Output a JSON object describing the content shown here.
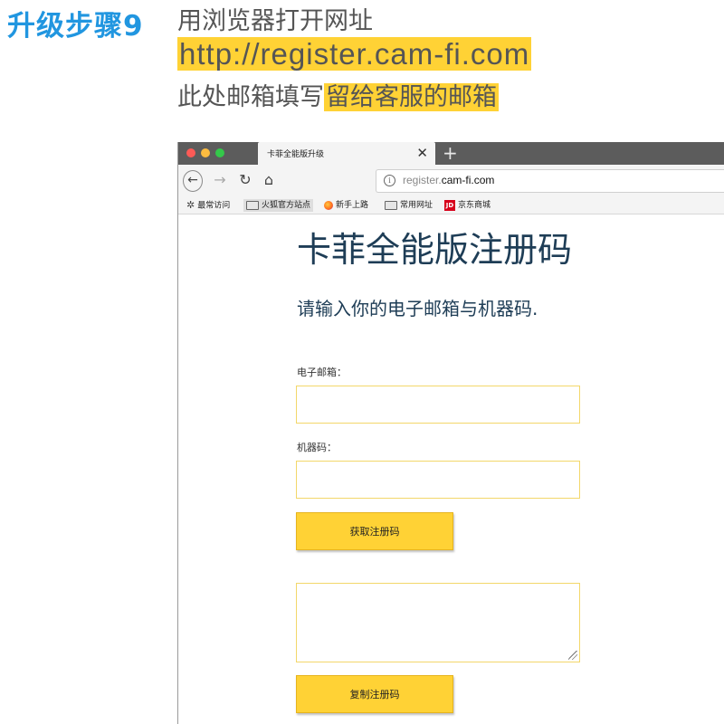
{
  "instructions": {
    "step_title": "升级步骤9",
    "line1": "用浏览器打开网址",
    "line2_url": "http://register.cam-fi.com",
    "line3_prefix": "此处邮箱填写",
    "line3_highlight": "留给客服的邮箱"
  },
  "browser": {
    "tab_title": "卡菲全能版升级",
    "tab_close": "✕",
    "new_tab": "+",
    "nav": {
      "back": "←",
      "forward": "→",
      "reload": "↻",
      "home": "⌂"
    },
    "url_info": "i",
    "url_prefix": "register.",
    "url_host": "cam-fi.com",
    "bookmarks": [
      {
        "label": "最常访问",
        "icon": "gear-icon"
      },
      {
        "label": "火狐官方站点",
        "icon": "folder-icon"
      },
      {
        "label": "新手上路",
        "icon": "firefox-icon"
      },
      {
        "label": "常用网址",
        "icon": "folder-icon"
      },
      {
        "label": "京东商城",
        "icon": "jd-icon"
      }
    ],
    "jd_logo": "JD"
  },
  "form": {
    "title": "卡菲全能版注册码",
    "subtitle": "请输入你的电子邮箱与机器码.",
    "email_label": "电子邮箱：",
    "email_value": "",
    "machine_label": "机器码：",
    "machine_value": "",
    "get_code_button": "获取注册码",
    "code_value": "",
    "copy_code_button": "复制注册码"
  },
  "colors": {
    "step_title": "#2196e0",
    "highlight": "#ffd235",
    "button": "#ffd235",
    "heading": "#1e3d56"
  }
}
